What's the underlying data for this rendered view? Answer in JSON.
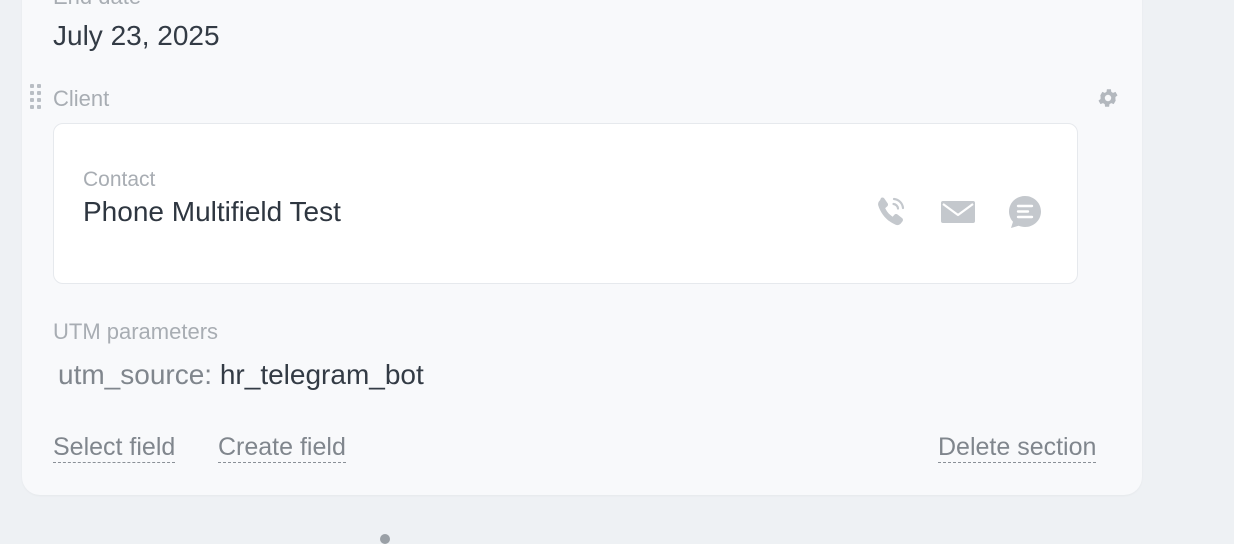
{
  "end_date": {
    "label": "End date",
    "value": "July 23, 2025"
  },
  "client_section": {
    "label": "Client",
    "contact": {
      "type_label": "Contact",
      "name": "Phone Multifield Test",
      "actions": [
        "phone-icon",
        "mail-icon",
        "chat-icon"
      ]
    }
  },
  "utm": {
    "label": "UTM parameters",
    "key": "utm_source:",
    "value": "hr_telegram_bot"
  },
  "footer": {
    "select_field": "Select field",
    "create_field": "Create field",
    "delete_section": "Delete section"
  }
}
